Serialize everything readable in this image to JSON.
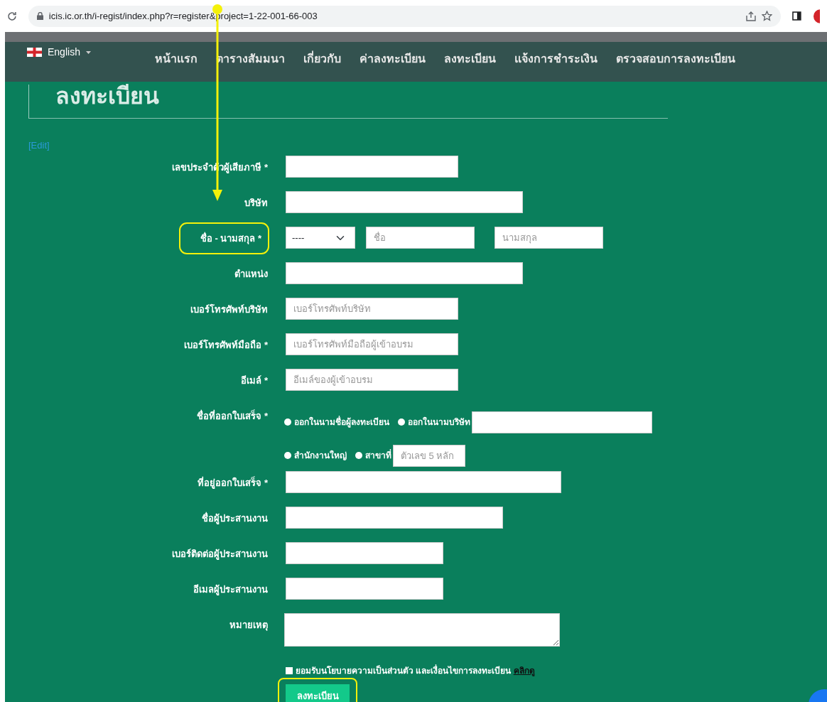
{
  "browser": {
    "url": "icis.ic.or.th/i-regist/index.php?r=register&project=1-22-001-66-003"
  },
  "nav": {
    "language": "English",
    "items": [
      {
        "label": "หน้าแรก"
      },
      {
        "label": "ตารางสัมมนา"
      },
      {
        "label": "เกี่ยวกับ"
      },
      {
        "label": "ค่าลงทะเบียน"
      },
      {
        "label": "ลงทะเบียน"
      },
      {
        "label": "แจ้งการชำระเงิน"
      },
      {
        "label": "ตรวจสอบการลงทะเบียน"
      }
    ]
  },
  "page_title": "ลงทะเบียน",
  "edit_link": "[Edit]",
  "form": {
    "rows": [
      {
        "kind": "text",
        "label": "เลขประจำตัวผู้เสียภาษี *",
        "highlighted": false,
        "placeholder": ""
      },
      {
        "kind": "text",
        "label": "บริษัท",
        "highlighted": false,
        "placeholder": ""
      },
      {
        "kind": "name",
        "label": "ชื่อ - นามสกุล *",
        "highlighted": true,
        "select_value": "----",
        "first_placeholder": "ชื่อ",
        "last_placeholder": "นามสกุล"
      },
      {
        "kind": "text",
        "label": "ตำแหน่ง",
        "highlighted": false,
        "placeholder": ""
      },
      {
        "kind": "text",
        "label": "เบอร์โทรศัพท์บริษัท",
        "highlighted": false,
        "placeholder": "เบอร์โทรศัพท์บริษัท"
      },
      {
        "kind": "text",
        "label": "เบอร์โทรศัพท์มือถือ *",
        "highlighted": false,
        "placeholder": "เบอร์โทรศัพท์มือถือผู้เข้าอบรม"
      },
      {
        "kind": "text",
        "label": "อีเมล์ *",
        "highlighted": false,
        "placeholder": "อีเมล์ของผู้เข้าอบรม"
      },
      {
        "kind": "radios",
        "label": "ชื่อที่ออกใบเสร็จ *",
        "highlighted": false,
        "options": [
          {
            "label": "ออกในนามชื่อผู้ลงทะเบียน",
            "selected": false
          },
          {
            "label": "ออกในนามบริษัท",
            "selected": false
          }
        ],
        "placeholder": ""
      },
      {
        "kind": "radios",
        "options": [
          {
            "label": "สำนักงานใหญ่",
            "selected": false
          },
          {
            "label": "สาขาที่",
            "selected": false
          }
        ],
        "placeholder": "ตัวเลข 5 หลัก"
      },
      {
        "kind": "text",
        "label": "ที่อยู่ออกใบเสร็จ *",
        "highlighted": false,
        "placeholder": ""
      },
      {
        "kind": "text",
        "label": "ชื่อผู้ประสานงาน",
        "highlighted": false,
        "placeholder": ""
      },
      {
        "kind": "text",
        "label": "เบอร์ติดต่อผู้ประสานงาน",
        "highlighted": false,
        "placeholder": ""
      },
      {
        "kind": "text",
        "label": "อีเมลผู้ประสานงาน",
        "highlighted": false,
        "placeholder": ""
      },
      {
        "kind": "textarea",
        "label": "หมายเหตุ",
        "highlighted": false,
        "placeholder": ""
      }
    ]
  },
  "consent": {
    "checked": false,
    "text": "ยอมรับนโยบายความเป็นส่วนตัว และเงื่อนไขการลงทะเบียน",
    "link": "คลิกดู"
  },
  "submit": {
    "label": "ลงทะเบียน",
    "highlighted": true
  }
}
